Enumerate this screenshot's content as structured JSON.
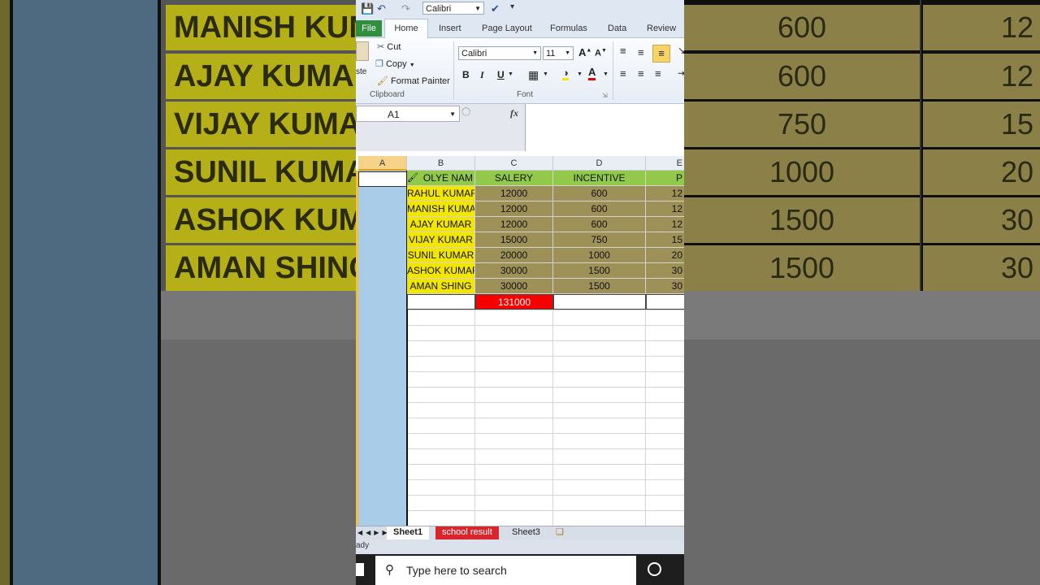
{
  "background": {
    "names": [
      "MANISH KUMA",
      "AJAY KUMAR",
      "VIJAY KUMA",
      "SUNIL KUMA",
      "ASHOK KUMA",
      "AMAN SHINC"
    ],
    "incentives": [
      "600",
      "600",
      "750",
      "1000",
      "1500",
      "1500"
    ],
    "right_fragments": [
      "12",
      "12",
      "15",
      "20",
      "30",
      "30"
    ]
  },
  "qat": {
    "font": "Calibri"
  },
  "ribbon_tabs": [
    "File",
    "Home",
    "Insert",
    "Page Layout",
    "Formulas",
    "Data",
    "Review"
  ],
  "clipboard": {
    "paste": "ste",
    "cut": "Cut",
    "copy": "Copy",
    "format_painter": "Format Painter",
    "label": "Clipboard"
  },
  "font_group": {
    "font": "Calibri",
    "size": "11",
    "bold": "B",
    "italic": "I",
    "underline": "U",
    "label": "Font"
  },
  "formula_bar": {
    "name_box": "A1",
    "fx": "fx"
  },
  "columns": [
    "A",
    "B",
    "C",
    "D",
    "E"
  ],
  "sheet": {
    "headers": [
      "OLYE  NAM",
      "SALERY",
      "INCENTIVE",
      "P"
    ],
    "rows": [
      {
        "name": "RAHUL KUMAR",
        "salary": "12000",
        "incentive": "600",
        "extra": "12"
      },
      {
        "name": "MANISH KUMAI",
        "salary": "12000",
        "incentive": "600",
        "extra": "12"
      },
      {
        "name": "AJAY KUMAR",
        "salary": "12000",
        "incentive": "600",
        "extra": "12"
      },
      {
        "name": "VIJAY KUMAR",
        "salary": "15000",
        "incentive": "750",
        "extra": "15"
      },
      {
        "name": "SUNIL KUMAR",
        "salary": "20000",
        "incentive": "1000",
        "extra": "20"
      },
      {
        "name": "ASHOK KUMAR",
        "salary": "30000",
        "incentive": "1500",
        "extra": "30"
      },
      {
        "name": "AMAN SHING",
        "salary": "30000",
        "incentive": "1500",
        "extra": "30"
      }
    ],
    "total": "131000"
  },
  "sheet_tabs": [
    "Sheet1",
    "school result",
    "Sheet3"
  ],
  "status": "ady",
  "taskbar": {
    "search_placeholder": "Type here to search"
  }
}
